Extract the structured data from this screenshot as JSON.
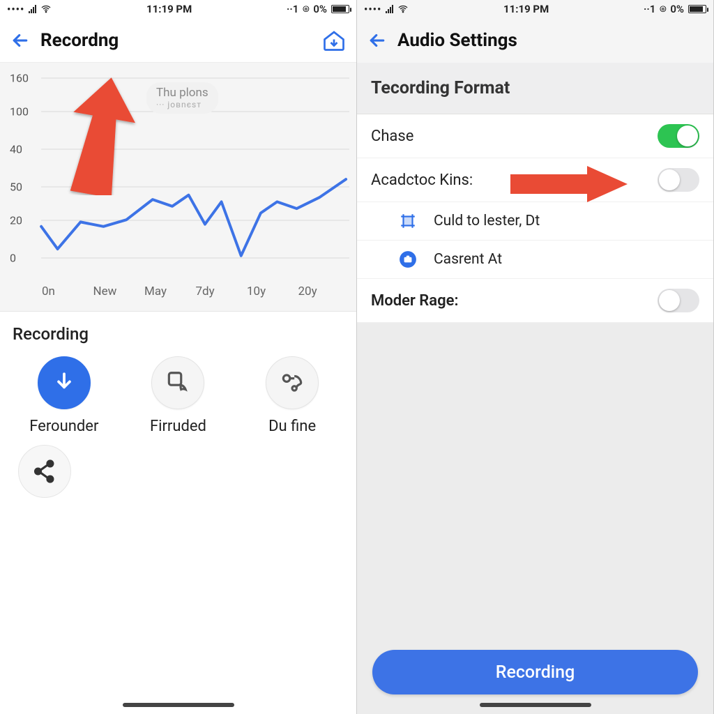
{
  "status": {
    "time": "11:19 PM",
    "carrier_tag": "··1",
    "battery_text": "0%",
    "shield_glyph": "⌾"
  },
  "left": {
    "title": "Recordng",
    "anno_top": "Thu plons",
    "anno_sub": "··· joвnєsт",
    "section_title": "Recording",
    "actions": {
      "ferounder": "Ferounder",
      "firruded": "Firruded",
      "du_fine": "Du fine"
    }
  },
  "right": {
    "title": "Audio Settings",
    "group_header": "Tecording Format",
    "rows": {
      "chase": "Chase",
      "acadctoc": "Acadctoc Kins:",
      "culd": "Culd to lester, Dt",
      "casrent": "Casrent At",
      "moder": "Moder Rage:"
    },
    "cta": "Recording"
  },
  "chart_data": {
    "type": "line",
    "title": "",
    "xlabel": "",
    "ylabel": "",
    "y_ticks": [
      0,
      20,
      50,
      40,
      100,
      160
    ],
    "categories": [
      "0n",
      "New",
      "May",
      "7dy",
      "10y",
      "20y"
    ],
    "x": [
      0,
      0.5,
      1.2,
      1.9,
      2.6,
      3.4,
      4.0,
      4.5,
      5.0,
      5.5,
      6.1,
      6.7,
      7.2,
      7.8,
      8.5,
      9.3
    ],
    "values": [
      28,
      8,
      32,
      28,
      34,
      52,
      46,
      56,
      30,
      50,
      2,
      40,
      50,
      44,
      54,
      70
    ],
    "ylim": [
      0,
      160
    ]
  }
}
